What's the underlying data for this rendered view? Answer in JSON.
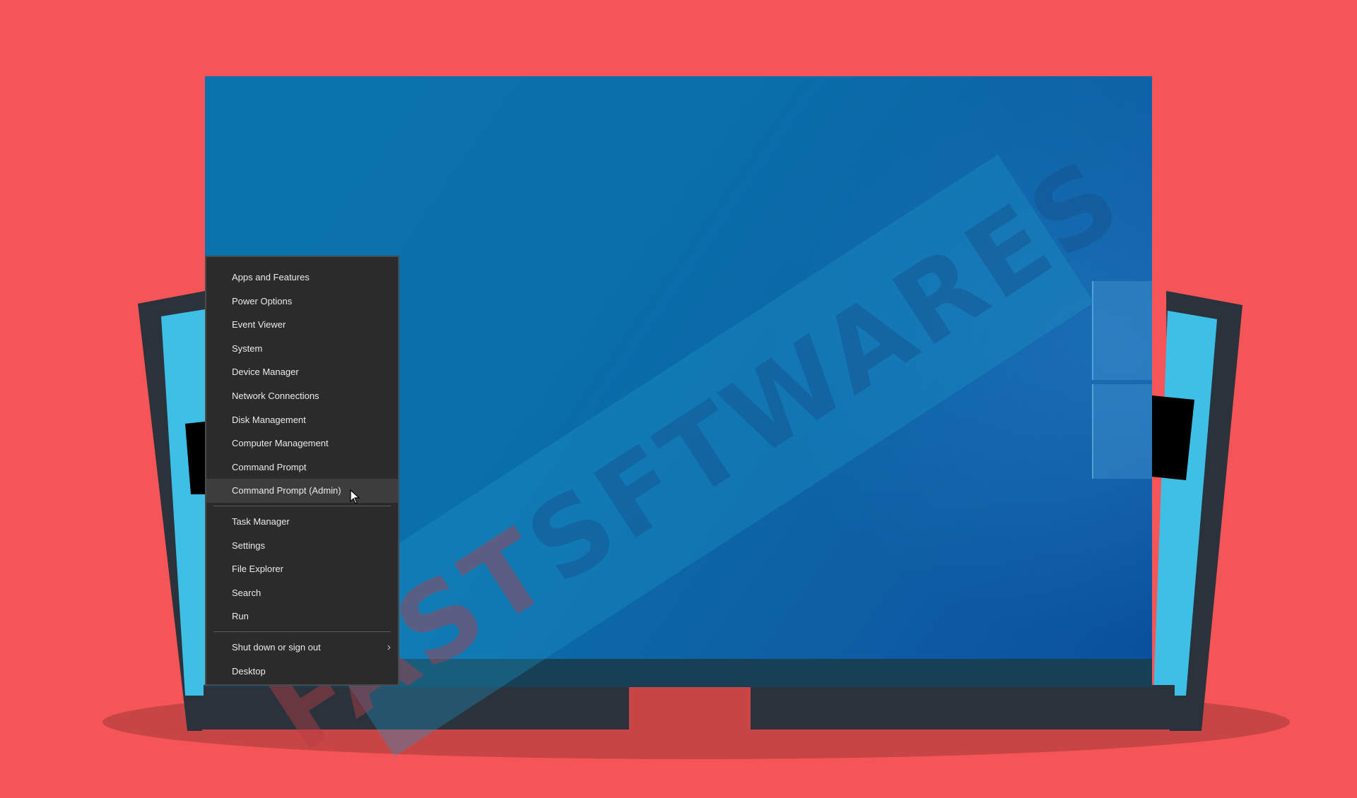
{
  "colors": {
    "background": "#f65557",
    "desktop": "#0a6fab",
    "menu_background": "#2b2b2b",
    "menu_text": "#eaeaea",
    "monitor_frame": "#2a333b",
    "side_screen": "#3ec0e6"
  },
  "watermark": {
    "part1": "FAST",
    "part2": "S",
    "part3": "FTWARES"
  },
  "context_menu": {
    "group1": [
      {
        "label": "Apps and Features"
      },
      {
        "label": "Power Options"
      },
      {
        "label": "Event Viewer"
      },
      {
        "label": "System"
      },
      {
        "label": "Device Manager"
      },
      {
        "label": "Network Connections"
      },
      {
        "label": "Disk Management"
      },
      {
        "label": "Computer Management"
      },
      {
        "label": "Command Prompt"
      },
      {
        "label": "Command Prompt (Admin)",
        "hovered": true
      }
    ],
    "group2": [
      {
        "label": "Task Manager"
      },
      {
        "label": "Settings"
      },
      {
        "label": "File Explorer"
      },
      {
        "label": "Search"
      },
      {
        "label": "Run"
      }
    ],
    "group3": [
      {
        "label": "Shut down or sign out",
        "submenu_icon": "chevron-right-icon"
      },
      {
        "label": "Desktop"
      }
    ]
  }
}
